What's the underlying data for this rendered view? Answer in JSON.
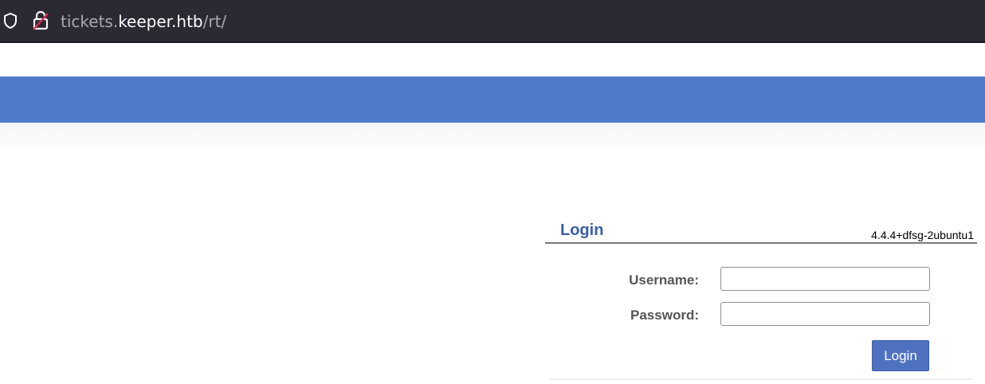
{
  "browser": {
    "url_prefix": "tickets.",
    "url_domain": "keeper.htb",
    "url_path": "/rt/",
    "icons": [
      "shield-icon",
      "lock-icon"
    ]
  },
  "colors": {
    "header_bar": "#507bcb",
    "title": "#3a5ea8",
    "button": "#4f72c0"
  },
  "login": {
    "title": "Login",
    "version": "4.4.4+dfsg-2ubuntu1",
    "username_label": "Username:",
    "username_value": "",
    "password_label": "Password:",
    "password_value": "",
    "submit_label": "Login"
  }
}
